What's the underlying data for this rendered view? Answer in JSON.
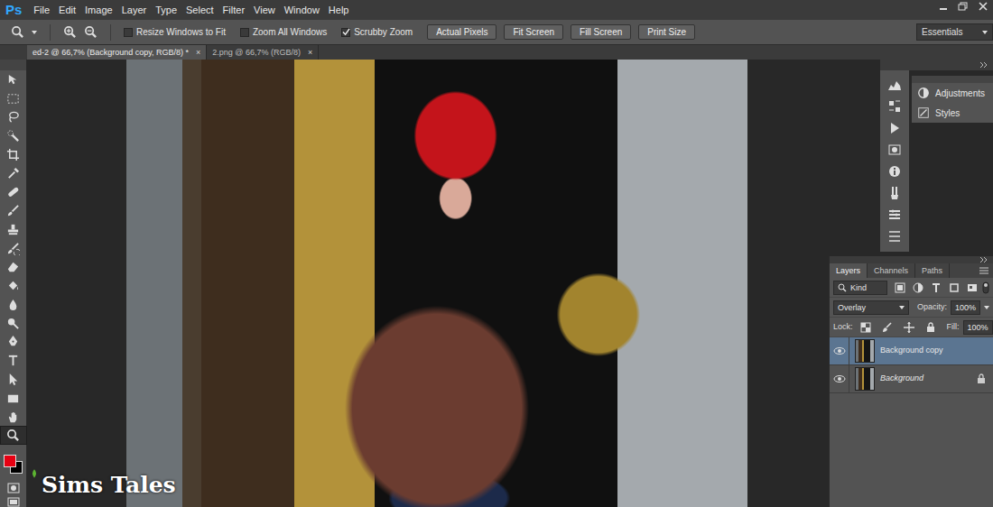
{
  "app": {
    "logo": "Ps"
  },
  "menu": [
    "File",
    "Edit",
    "Image",
    "Layer",
    "Type",
    "Select",
    "Filter",
    "View",
    "Window",
    "Help"
  ],
  "options_bar": {
    "checkboxes": [
      {
        "label": "Resize Windows to Fit",
        "checked": false
      },
      {
        "label": "Zoom All Windows",
        "checked": false
      },
      {
        "label": "Scrubby Zoom",
        "checked": true
      }
    ],
    "buttons": [
      "Actual Pixels",
      "Fit Screen",
      "Fill Screen",
      "Print Size"
    ],
    "workspace": "Essentials"
  },
  "documents": [
    {
      "label": "ed-2 @ 66,7% (Background copy, RGB/8) *",
      "close": "×",
      "selected": true
    },
    {
      "label": "2.png @ 66,7% (RGB/8)",
      "close": "×",
      "selected": false
    }
  ],
  "tools": [
    {
      "selected": false
    },
    {
      "selected": false
    },
    {
      "selected": false
    },
    {
      "selected": false
    },
    {
      "selected": false
    },
    {
      "selected": false
    },
    {
      "selected": false
    },
    {
      "selected": false
    },
    {
      "selected": false
    },
    {
      "selected": false
    },
    {
      "selected": false
    },
    {
      "selected": false
    },
    {
      "selected": false
    },
    {
      "selected": false
    },
    {
      "selected": false
    },
    {
      "selected": false
    },
    {
      "selected": false
    },
    {
      "selected": false
    },
    {
      "selected": false
    },
    {
      "selected": true
    }
  ],
  "swatches": {
    "foreground": "#e60012",
    "background": "#000000"
  },
  "side_panel": {
    "items": [
      "Adjustments",
      "Styles"
    ]
  },
  "layers_panel": {
    "tabs": [
      {
        "label": "Layers",
        "selected": true
      },
      {
        "label": "Channels",
        "selected": false
      },
      {
        "label": "Paths",
        "selected": false
      }
    ],
    "filter": "Kind",
    "blend_mode": "Overlay",
    "opacity_label": "Opacity:",
    "opacity": "100%",
    "lock_label": "Lock:",
    "fill_label": "Fill:",
    "fill": "100%",
    "layers": [
      {
        "name": "Background copy",
        "selected": true,
        "visible": true,
        "locked": false,
        "italic": false
      },
      {
        "name": "Background",
        "selected": false,
        "visible": true,
        "locked": true,
        "italic": true
      }
    ]
  },
  "watermark": "Sims Tales"
}
